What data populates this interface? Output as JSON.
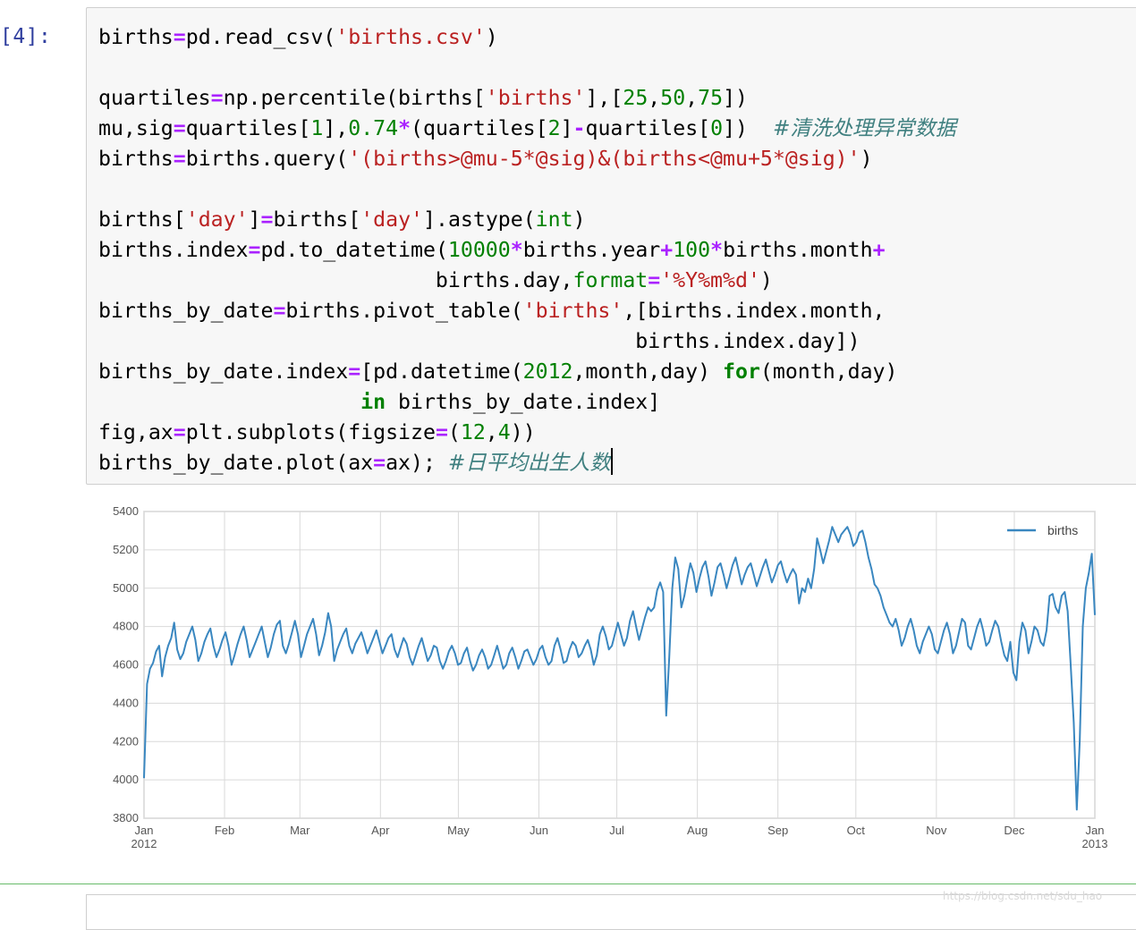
{
  "cell": {
    "prompt": "[4]:",
    "code_lines": [
      [
        [
          "births"
        ],
        [
          "=",
          "op"
        ],
        [
          "pd.read_csv("
        ],
        [
          "'births.csv'",
          "s"
        ],
        [
          ")"
        ]
      ],
      [],
      [
        [
          "quartiles"
        ],
        [
          "=",
          "op"
        ],
        [
          "np.percentile(births["
        ],
        [
          "'births'",
          "s"
        ],
        [
          "],["
        ],
        [
          "25",
          "n"
        ],
        [
          ","
        ],
        [
          "50",
          "n"
        ],
        [
          ","
        ],
        [
          "75",
          "n"
        ],
        [
          "])"
        ]
      ],
      [
        [
          "mu,sig"
        ],
        [
          "=",
          "op"
        ],
        [
          "quartiles["
        ],
        [
          "1",
          "n"
        ],
        [
          "],"
        ],
        [
          "0.74",
          "n"
        ],
        [
          "*",
          "op"
        ],
        [
          "(quartiles["
        ],
        [
          "2",
          "n"
        ],
        [
          "]"
        ],
        [
          "-",
          "op"
        ],
        [
          "quartiles["
        ],
        [
          "0",
          "n"
        ],
        [
          "])  "
        ],
        [
          "#清洗处理异常数据",
          "c"
        ]
      ],
      [
        [
          "births"
        ],
        [
          "=",
          "op"
        ],
        [
          "births.query("
        ],
        [
          "'(births>@mu-5*@sig)&(births<@mu+5*@sig)'",
          "s"
        ],
        [
          ")"
        ]
      ],
      [],
      [
        [
          "births["
        ],
        [
          "'day'",
          "s"
        ],
        [
          "]"
        ],
        [
          "=",
          "op"
        ],
        [
          "births["
        ],
        [
          "'day'",
          "s"
        ],
        [
          "].astype("
        ],
        [
          "int",
          "n"
        ],
        [
          ")"
        ]
      ],
      [
        [
          "births.index"
        ],
        [
          "=",
          "op"
        ],
        [
          "pd.to_datetime("
        ],
        [
          "10000",
          "n"
        ],
        [
          "*",
          "op"
        ],
        [
          "births.year"
        ],
        [
          "+",
          "op"
        ],
        [
          "100",
          "n"
        ],
        [
          "*",
          "op"
        ],
        [
          "births.month"
        ],
        [
          "+",
          "op"
        ]
      ],
      [
        [
          "                           births.day,"
        ],
        [
          "format",
          "n"
        ],
        [
          "=",
          "op"
        ],
        [
          "'%Y%m%d'",
          "s"
        ],
        [
          ")"
        ]
      ],
      [
        [
          "births_by_date"
        ],
        [
          "=",
          "op"
        ],
        [
          "births.pivot_table("
        ],
        [
          "'births'",
          "s"
        ],
        [
          ",[births.index.month,"
        ]
      ],
      [
        [
          "                                           births.index.day])"
        ]
      ],
      [
        [
          "births_by_date.index"
        ],
        [
          "=",
          "op"
        ],
        [
          "[pd.datetime("
        ],
        [
          "2012",
          "n"
        ],
        [
          ",month,day) "
        ],
        [
          "for",
          "kw"
        ],
        [
          "(month,day)"
        ]
      ],
      [
        [
          "                     "
        ],
        [
          "in",
          "kw"
        ],
        [
          " births_by_date.index]"
        ]
      ],
      [
        [
          "fig,ax"
        ],
        [
          "=",
          "op"
        ],
        [
          "plt.subplots(figsize"
        ],
        [
          "=",
          "op"
        ],
        [
          "("
        ],
        [
          "12",
          "n"
        ],
        [
          ","
        ],
        [
          "4",
          "n"
        ],
        [
          "))"
        ]
      ],
      [
        [
          "births_by_date.plot(ax"
        ],
        [
          "=",
          "op"
        ],
        [
          "ax); "
        ],
        [
          "#日平均出生人数",
          "c"
        ],
        [
          "",
          "cursor"
        ]
      ]
    ]
  },
  "watermark": "https://blog.csdn.net/sdu_hao",
  "colors": {
    "series": "#3a87c0",
    "grid": "#d9d9d9",
    "prompt": "#303f9f"
  },
  "chart_data": {
    "type": "line",
    "legend": "births",
    "legend_position": "top-right",
    "grid": true,
    "ylim": [
      3800,
      5400
    ],
    "yticks": [
      "3800",
      "4000",
      "4200",
      "4400",
      "4600",
      "4800",
      "5000",
      "5200",
      "5400"
    ],
    "xticks": [
      {
        "label": "Jan",
        "sub": "2012",
        "day": 1
      },
      {
        "label": "Feb",
        "sub": "",
        "day": 32
      },
      {
        "label": "Mar",
        "sub": "",
        "day": 61
      },
      {
        "label": "Apr",
        "sub": "",
        "day": 92
      },
      {
        "label": "May",
        "sub": "",
        "day": 122
      },
      {
        "label": "Jun",
        "sub": "",
        "day": 153
      },
      {
        "label": "Jul",
        "sub": "",
        "day": 183
      },
      {
        "label": "Aug",
        "sub": "",
        "day": 214
      },
      {
        "label": "Sep",
        "sub": "",
        "day": 245
      },
      {
        "label": "Oct",
        "sub": "",
        "day": 275
      },
      {
        "label": "Nov",
        "sub": "",
        "day": 306
      },
      {
        "label": "Dec",
        "sub": "",
        "day": 336
      },
      {
        "label": "Jan",
        "sub": "2013",
        "day": 367
      }
    ],
    "x_start": "2012-01-01",
    "x_end": "2013-01-01",
    "series": [
      {
        "name": "births",
        "values": [
          4009,
          4500,
          4580,
          4610,
          4670,
          4700,
          4540,
          4640,
          4700,
          4740,
          4820,
          4680,
          4630,
          4660,
          4720,
          4760,
          4800,
          4730,
          4620,
          4660,
          4720,
          4760,
          4790,
          4700,
          4640,
          4680,
          4730,
          4770,
          4700,
          4600,
          4650,
          4710,
          4760,
          4800,
          4730,
          4640,
          4680,
          4720,
          4760,
          4800,
          4720,
          4640,
          4690,
          4760,
          4810,
          4830,
          4700,
          4660,
          4710,
          4770,
          4830,
          4760,
          4640,
          4700,
          4760,
          4800,
          4840,
          4760,
          4650,
          4700,
          4770,
          4870,
          4800,
          4620,
          4680,
          4720,
          4760,
          4790,
          4700,
          4660,
          4710,
          4740,
          4770,
          4720,
          4660,
          4700,
          4740,
          4780,
          4720,
          4660,
          4700,
          4740,
          4760,
          4680,
          4640,
          4690,
          4740,
          4710,
          4640,
          4600,
          4650,
          4700,
          4740,
          4680,
          4620,
          4650,
          4700,
          4690,
          4620,
          4580,
          4620,
          4670,
          4700,
          4660,
          4600,
          4610,
          4660,
          4690,
          4620,
          4570,
          4600,
          4650,
          4680,
          4640,
          4580,
          4600,
          4650,
          4700,
          4640,
          4580,
          4600,
          4660,
          4690,
          4640,
          4580,
          4620,
          4670,
          4680,
          4640,
          4600,
          4630,
          4680,
          4700,
          4640,
          4600,
          4620,
          4700,
          4740,
          4680,
          4610,
          4620,
          4680,
          4720,
          4700,
          4640,
          4660,
          4700,
          4730,
          4680,
          4600,
          4650,
          4760,
          4800,
          4750,
          4680,
          4700,
          4760,
          4820,
          4760,
          4700,
          4740,
          4830,
          4880,
          4800,
          4730,
          4790,
          4850,
          4900,
          4880,
          4900,
          4990,
          5030,
          4980,
          4335,
          4640,
          5000,
          5160,
          5100,
          4900,
          4960,
          5050,
          5130,
          5080,
          4980,
          5050,
          5110,
          5140,
          5060,
          4960,
          5030,
          5110,
          5130,
          5070,
          5000,
          5060,
          5120,
          5160,
          5090,
          5020,
          5070,
          5110,
          5130,
          5070,
          5010,
          5060,
          5110,
          5150,
          5090,
          5030,
          5070,
          5120,
          5140,
          5080,
          5030,
          5070,
          5100,
          5070,
          4920,
          5000,
          4980,
          5050,
          5000,
          5100,
          5260,
          5200,
          5130,
          5190,
          5250,
          5320,
          5280,
          5240,
          5280,
          5300,
          5320,
          5280,
          5220,
          5240,
          5290,
          5300,
          5240,
          5160,
          5100,
          5020,
          5000,
          4960,
          4900,
          4860,
          4820,
          4800,
          4840,
          4780,
          4700,
          4740,
          4800,
          4840,
          4780,
          4700,
          4660,
          4720,
          4760,
          4800,
          4760,
          4680,
          4660,
          4720,
          4780,
          4820,
          4760,
          4660,
          4700,
          4770,
          4840,
          4820,
          4700,
          4680,
          4740,
          4800,
          4840,
          4780,
          4700,
          4720,
          4780,
          4830,
          4800,
          4720,
          4650,
          4620,
          4720,
          4560,
          4520,
          4720,
          4820,
          4780,
          4660,
          4720,
          4800,
          4780,
          4720,
          4700,
          4780,
          4960,
          4970,
          4900,
          4870,
          4960,
          4980,
          4880,
          4600,
          4300,
          3845,
          4200,
          4800,
          5000,
          5080,
          5180,
          4860
        ]
      }
    ]
  }
}
